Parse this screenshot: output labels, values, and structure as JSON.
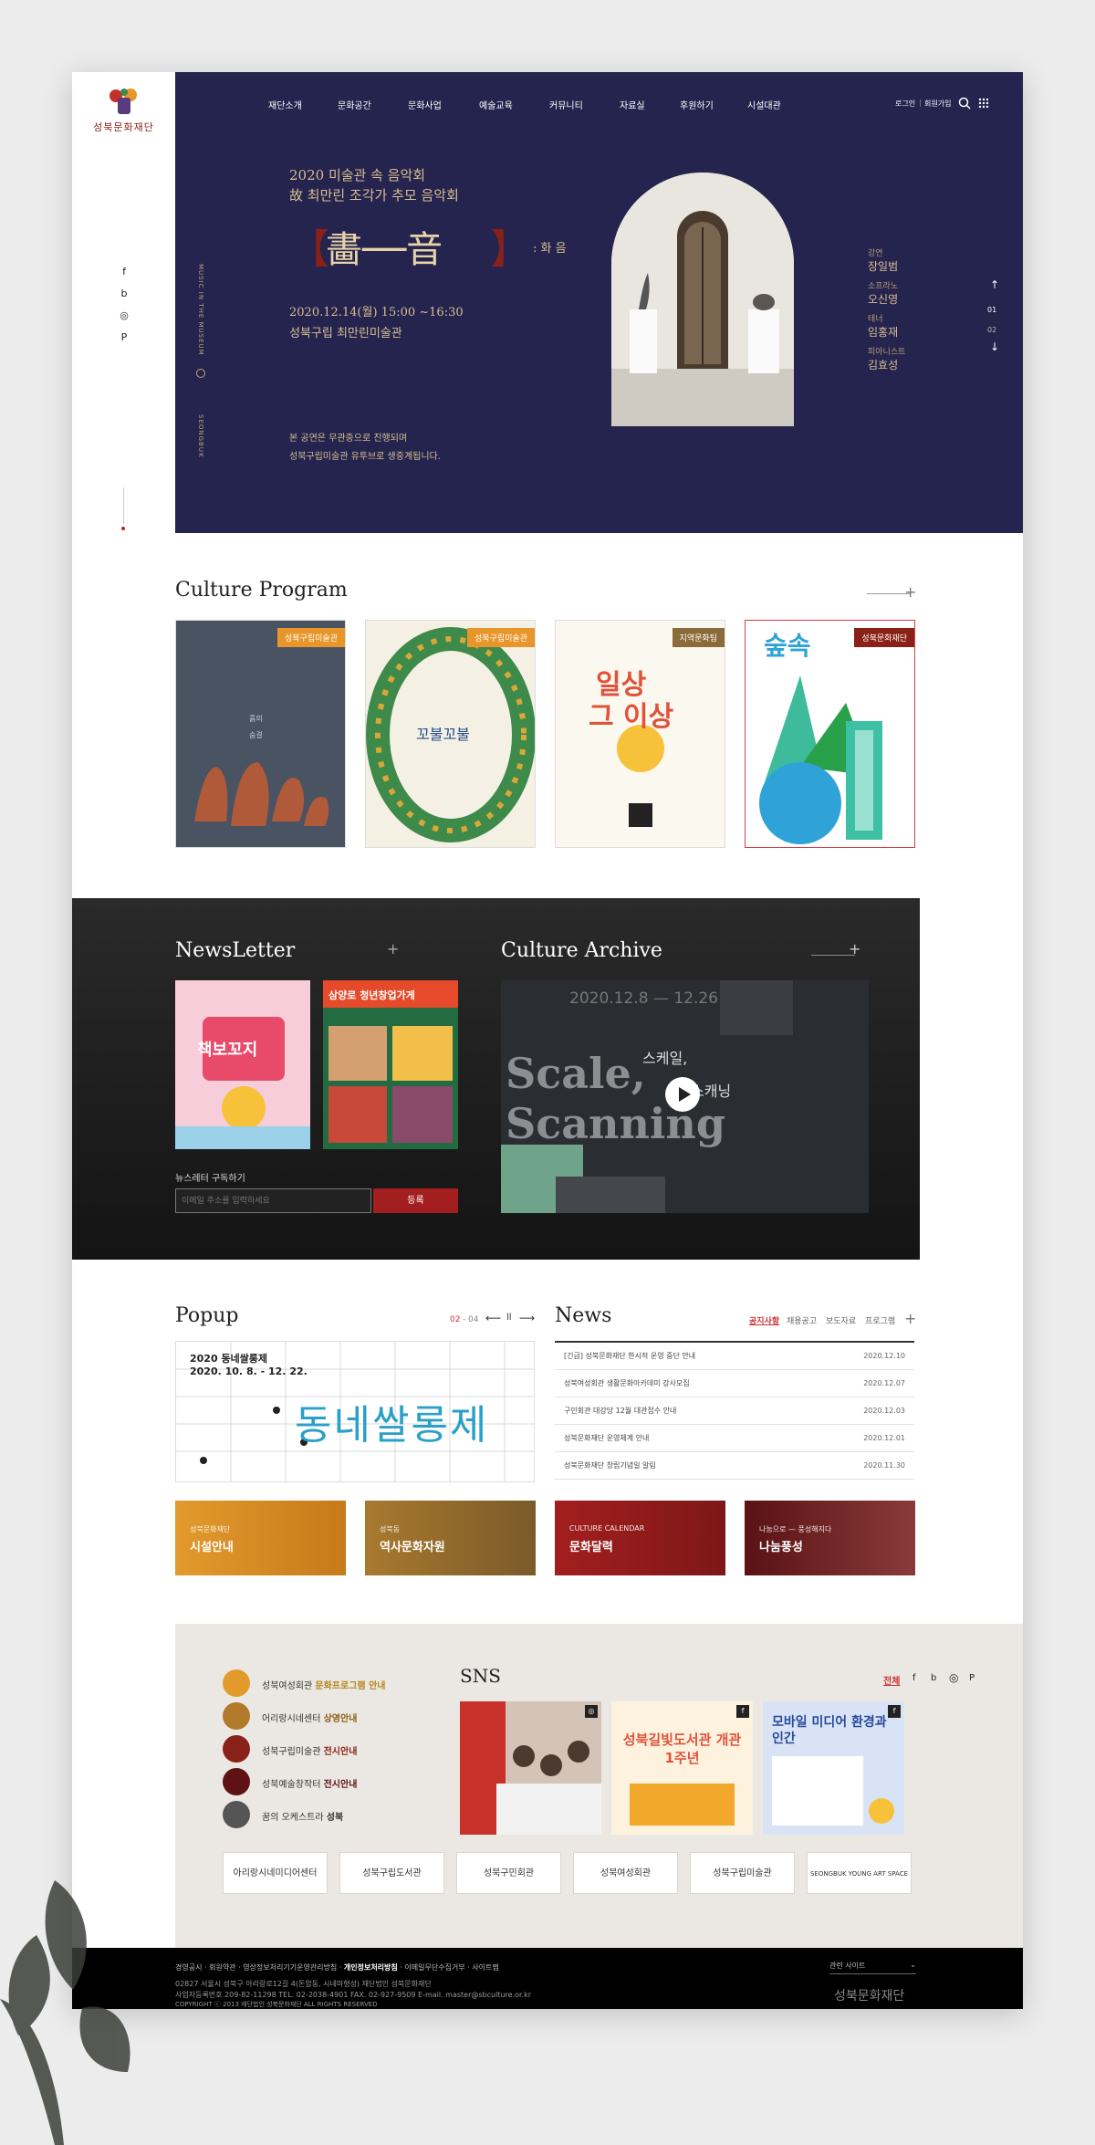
{
  "brand": {
    "name": "성북문화재단"
  },
  "nav": {
    "items": [
      "재단소개",
      "문화공간",
      "문화사업",
      "예술교육",
      "커뮤니티",
      "자료실",
      "후원하기",
      "시설대관"
    ],
    "login": "로그인",
    "join": "회원가입"
  },
  "side_sns": [
    "f",
    "b",
    "◎",
    "P"
  ],
  "hero": {
    "line1": "2020 미술관 속 음악회",
    "line2": "故 최만린 조각가 추모 음악회",
    "big_title": "畵──音",
    "big_sub": ": 화 음",
    "date": "2020.12.14(월) 15:00 ~16:30",
    "venue": "성북구립 최만린미술관",
    "note1": "본 공연은 무관중으로 진행되며",
    "note2": "성북구립미술관 유투브로 생중계됩니다.",
    "performers": [
      {
        "role": "강연",
        "name": "장일범"
      },
      {
        "role": "소프라노",
        "name": "오신영"
      },
      {
        "role": "테너",
        "name": "임홍재"
      },
      {
        "role": "피아니스트",
        "name": "김효성"
      }
    ],
    "pager": {
      "current": "01",
      "total": "02"
    }
  },
  "culture_program": {
    "title": "Culture Program",
    "items": [
      {
        "tag": "성북구립미술관",
        "tag_color": "#e8952a"
      },
      {
        "tag": "성북구립미술관",
        "tag_color": "#e8952a"
      },
      {
        "tag": "지역문화팀",
        "tag_color": "#8b6b3a",
        "poster_title_1": "일상",
        "poster_title_2": "그 이상"
      },
      {
        "tag": "성북문화재단",
        "tag_color": "#8a2118",
        "poster_title_1": "숲속"
      }
    ]
  },
  "newsletter": {
    "title": "NewsLetter",
    "subscribe_label": "뉴스레터 구독하기",
    "email_placeholder": "이메일 주소를 입력하세요",
    "submit": "등록",
    "poster_a": "책보꼬지",
    "poster_b": "삼양로 청년창업가게"
  },
  "archive": {
    "title": "Culture Archive",
    "date": "2020.12.8 — 12.26",
    "title_a": "Scale,",
    "title_b": "Scanning",
    "title_kr_a": "스케일,",
    "title_kr_b": "스캐닝"
  },
  "popup": {
    "title": "Popup",
    "counter": "02",
    "counter_total": "04",
    "poster_title": "2020 동네쌀롱제",
    "poster_date": "2020. 10. 8. - 12. 22.",
    "poster_big": "동네쌀롱제"
  },
  "news": {
    "title": "News",
    "tabs": [
      "공지사항",
      "채용공고",
      "보도자료",
      "프로그램"
    ],
    "rows": [
      {
        "title": "[긴급] 성북문화재단 한시적 운영 중단 안내",
        "date": "2020.12.10"
      },
      {
        "title": "성북여성회관 생활문화아카데미 강사모집",
        "date": "2020.12.07"
      },
      {
        "title": "구민회관 대강당 12월 대관접수 안내",
        "date": "2020.12.03"
      },
      {
        "title": "성북문화재단 운영체계 안내",
        "date": "2020.12.01"
      },
      {
        "title": "성북문화재단 창립기념일 알림",
        "date": "2020.11.30"
      }
    ]
  },
  "quick_cards": [
    {
      "small": "성북문화재단",
      "label": "시설안내",
      "color": "#e39a2c"
    },
    {
      "small": "성북동",
      "label": "역사문화자원",
      "color": "#a9792e"
    },
    {
      "small": "CULTURE CALENDAR",
      "label": "문화달력",
      "color": "#a31e1e"
    },
    {
      "small": "나눔으로 — 풍성해지다",
      "label": "나눔풍성",
      "color": "#6d1518"
    }
  ],
  "institutions": [
    {
      "name": "성북여성회관",
      "highlight": "문화프로그램 안내",
      "color": "#e39a2c"
    },
    {
      "name": "어리랑시네센터",
      "highlight": "상영안내",
      "color": "#b07a2a"
    },
    {
      "name": "성북구립미술관",
      "highlight": "전시안내",
      "color": "#8a2118"
    },
    {
      "name": "성북예술창작터",
      "highlight": "전시안내",
      "color": "#5f1214"
    },
    {
      "name": "꿈의 오케스트라",
      "highlight": "성북",
      "color": "#555555"
    }
  ],
  "sns": {
    "title": "SNS",
    "filters": [
      "전체",
      "f",
      "b",
      "◎",
      "P"
    ],
    "img2_title": "성북길빛도서관 개관 1주년",
    "img3_title": "모바일 미디어 환경과 인간"
  },
  "banners": [
    "아리랑시네미디어센터",
    "성북구립도서관",
    "성북구민회관",
    "성북여성회관",
    "성북구립미술관",
    "SEONGBUK YOUNG ART SPACE"
  ],
  "footer": {
    "links": [
      "경영공시",
      "회원약관",
      "영상정보처리기기운영관리방침",
      "개인정보처리방침",
      "이메일무단수집거부",
      "사이트맵"
    ],
    "address": "02827 서울시 성북구 아리랑로12길 4(돈암동, 시네마형성) 재단법인 성북문화재단",
    "bizno": "사업자등록번호 209-82-11298    TEL. 02-2038-4901    FAX. 02-927-9509    E-mail. master@sbculture.or.kr",
    "copyright": "COPYRIGHT ⓒ 2013 재단법인 성북문화재단 ALL RIGHTS RESERVED",
    "related": "관련 사이트",
    "brand": "성북문화재단"
  }
}
